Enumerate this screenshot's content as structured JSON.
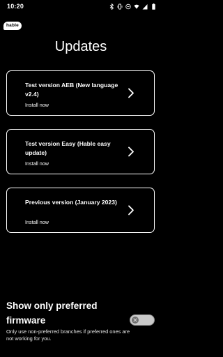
{
  "status_bar": {
    "time": "10:20",
    "icons": [
      "bluetooth-icon",
      "vibrate-icon",
      "do-not-disturb-icon",
      "wifi-icon",
      "cellular-signal-icon",
      "battery-icon"
    ]
  },
  "app": {
    "logo_text": "hable"
  },
  "page": {
    "title": "Updates"
  },
  "firmware_options": [
    {
      "title": "Test version AEB (New language v2.4)",
      "subtitle": "Install now",
      "icon": "chevron-right-icon"
    },
    {
      "title": "Test version Easy (Hable easy update)",
      "subtitle": "Install now",
      "icon": "chevron-right-icon"
    },
    {
      "title": "Previous version (January 2023)",
      "subtitle": "Install now",
      "icon": "chevron-right-icon"
    }
  ],
  "preferred_setting": {
    "title": "Show only preferred firmware",
    "description": "Only use non-preferred branches if preferred ones are not working for you.",
    "toggle_state": "off",
    "toggle_icon": "close-icon"
  },
  "colors": {
    "background": "#000000",
    "text": "#ffffff",
    "toggle_track": "#c9c9c9",
    "toggle_thumb": "#6e6e6e"
  }
}
